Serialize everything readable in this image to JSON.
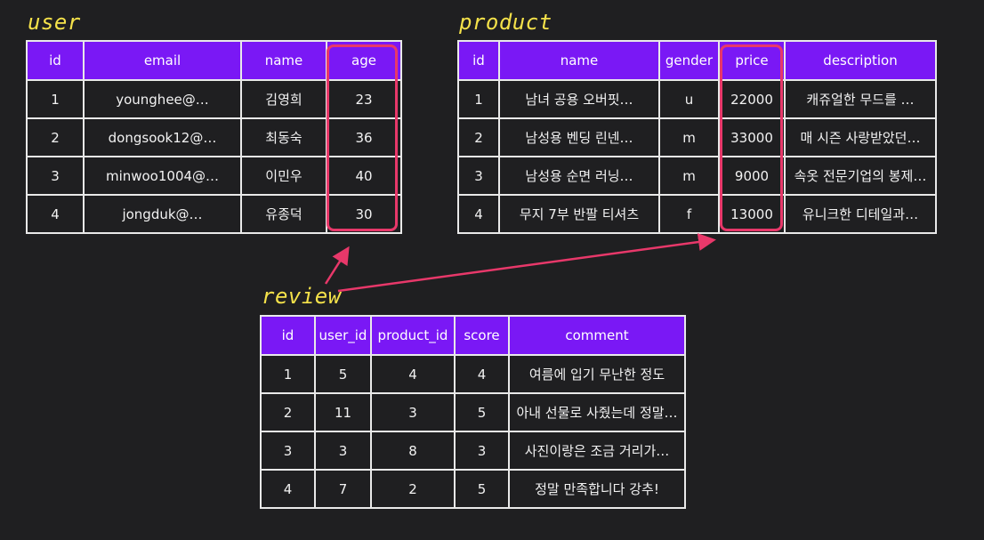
{
  "titles": {
    "user": "user",
    "product": "product",
    "review": "review"
  },
  "user": {
    "headers": [
      "id",
      "email",
      "name",
      "age"
    ],
    "rows": [
      [
        "1",
        "younghee@…",
        "김영희",
        "23"
      ],
      [
        "2",
        "dongsook12@…",
        "최동숙",
        "36"
      ],
      [
        "3",
        "minwoo1004@…",
        "이민우",
        "40"
      ],
      [
        "4",
        "jongduk@…",
        "유종덕",
        "30"
      ]
    ]
  },
  "product": {
    "headers": [
      "id",
      "name",
      "gender",
      "price",
      "description"
    ],
    "rows": [
      [
        "1",
        "남녀 공용 오버핏…",
        "u",
        "22000",
        "캐쥬얼한 무드를 …"
      ],
      [
        "2",
        "남성용 벤딩 린넨…",
        "m",
        "33000",
        "매 시즌 사랑받았던…"
      ],
      [
        "3",
        "남성용 순면 러닝…",
        "m",
        "9000",
        "속옷 전문기업의 봉제…"
      ],
      [
        "4",
        "무지 7부 반팔 티셔츠",
        "f",
        "13000",
        "유니크한 디테일과…"
      ]
    ]
  },
  "review": {
    "headers": [
      "id",
      "user_id",
      "product_id",
      "score",
      "comment"
    ],
    "rows": [
      [
        "1",
        "5",
        "4",
        "4",
        "여름에 입기 무난한 정도"
      ],
      [
        "2",
        "11",
        "3",
        "5",
        "아내 선물로 사줬는데 정말…"
      ],
      [
        "3",
        "3",
        "8",
        "3",
        "사진이랑은 조금 거리가…"
      ],
      [
        "4",
        "7",
        "2",
        "5",
        "정말 만족합니다 강추!"
      ]
    ]
  },
  "colors": {
    "background": "#1f1f21",
    "header": "#7a18f5",
    "highlight": "#e8386a",
    "title": "#f5e24a",
    "grid": "#e9e9e9"
  }
}
